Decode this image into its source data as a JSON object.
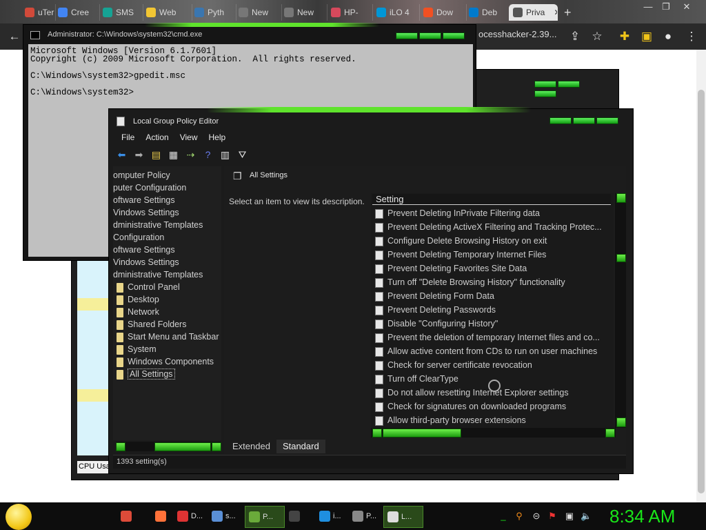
{
  "browser": {
    "tabs": [
      {
        "label": "uTer",
        "color": "#d14a3a"
      },
      {
        "label": "Cree",
        "color": "#4285f4"
      },
      {
        "label": "SMS",
        "color": "#16a394"
      },
      {
        "label": "Web",
        "color": "#f2c633"
      },
      {
        "label": "Pyth",
        "color": "#3a76b0"
      },
      {
        "label": "New",
        "color": "#777777"
      },
      {
        "label": "New",
        "color": "#777777"
      },
      {
        "label": "HP-",
        "color": "#d6495c"
      },
      {
        "label": "iLO 4",
        "color": "#0096d6"
      },
      {
        "label": "Dow",
        "color": "#f25022"
      },
      {
        "label": "Deb",
        "color": "#007acc"
      },
      {
        "label": "Priva",
        "color": "#555555"
      }
    ],
    "new_tab": "+",
    "address_text": "ocesshacker-2.39...",
    "controls": {
      "minimize": "—",
      "maximize": "❐",
      "close": "✕"
    }
  },
  "cmd": {
    "title": "Administrator: C:\\Windows\\system32\\cmd.exe",
    "lines": [
      "Microsoft Windows [Version 6.1.7601]",
      "Copyright (c) 2009 Microsoft Corporation.  All rights reserved.",
      "",
      "C:\\Windows\\system32>gpedit.msc",
      "",
      "C:\\Windows\\system32>"
    ]
  },
  "taskmgr": {
    "cpu_label": "CPU Usa"
  },
  "gpedit": {
    "title": "Local Group Policy Editor",
    "menu": [
      "File",
      "Action",
      "View",
      "Help"
    ],
    "tree": [
      {
        "label": "omputer Policy",
        "indent": 0,
        "folder": false
      },
      {
        "label": "puter Configuration",
        "indent": 0,
        "folder": false
      },
      {
        "label": "oftware Settings",
        "indent": 0,
        "folder": false
      },
      {
        "label": "Vindows Settings",
        "indent": 0,
        "folder": false
      },
      {
        "label": "dministrative Templates",
        "indent": 0,
        "folder": false
      },
      {
        "label": " Configuration",
        "indent": 0,
        "folder": false
      },
      {
        "label": "oftware Settings",
        "indent": 0,
        "folder": false
      },
      {
        "label": "Vindows Settings",
        "indent": 0,
        "folder": false
      },
      {
        "label": "dministrative Templates",
        "indent": 0,
        "folder": false
      },
      {
        "label": "Control Panel",
        "indent": 1,
        "folder": true
      },
      {
        "label": "Desktop",
        "indent": 1,
        "folder": true
      },
      {
        "label": "Network",
        "indent": 1,
        "folder": true
      },
      {
        "label": "Shared Folders",
        "indent": 1,
        "folder": true
      },
      {
        "label": "Start Menu and Taskbar",
        "indent": 1,
        "folder": true
      },
      {
        "label": "System",
        "indent": 1,
        "folder": true
      },
      {
        "label": "Windows Components",
        "indent": 1,
        "folder": true
      },
      {
        "label": "All Settings",
        "indent": 1,
        "folder": true,
        "selected": true
      }
    ],
    "header": "All Settings",
    "description": "Select an item to view its description.",
    "column_header": "Setting",
    "settings": [
      "Prevent Deleting InPrivate Filtering data",
      "Prevent Deleting ActiveX Filtering and Tracking Protec...",
      "Configure Delete Browsing History on exit",
      "Prevent Deleting Temporary Internet Files",
      "Prevent Deleting Favorites Site Data",
      "Turn off \"Delete Browsing History\" functionality",
      "Prevent Deleting Form Data",
      "Prevent Deleting Passwords",
      "Disable \"Configuring History\"",
      "Prevent the deletion of temporary Internet files and co...",
      "Allow active content from CDs to run on user machines",
      "Check for server certificate revocation",
      "Turn off ClearType",
      "Do not allow resetting Internet Explorer settings",
      "Check for signatures on downloaded programs",
      "Allow third-party browser extensions"
    ],
    "tabs": [
      "Extended",
      "Standard"
    ],
    "active_tab": "Standard",
    "status": "1393 setting(s)"
  },
  "taskbar": {
    "items": [
      {
        "label": "",
        "color": "#dd4b39"
      },
      {
        "label": "",
        "color": "#ff7139"
      },
      {
        "label": "D...",
        "color": "#d33"
      },
      {
        "label": "s...",
        "color": "#5a8fd6"
      },
      {
        "label": "P...",
        "color": "#6aaa3a",
        "active": true
      },
      {
        "label": "",
        "color": "#444"
      },
      {
        "label": "i...",
        "color": "#1f8fe0"
      },
      {
        "label": "P...",
        "color": "#888"
      },
      {
        "label": "L...",
        "color": "#ddd",
        "active": true
      }
    ],
    "clock": "8:34 AM"
  }
}
